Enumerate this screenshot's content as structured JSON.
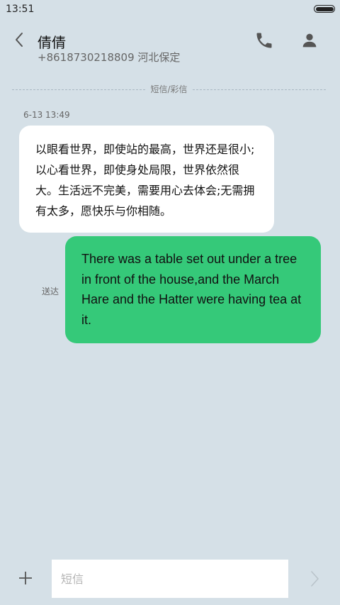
{
  "status_bar": {
    "time": "13:51",
    "battery_level": 1.0
  },
  "header": {
    "contact_name": "倩倩",
    "contact_sub": "+8618730218809 河北保定",
    "icons": {
      "back": "back-chevron-icon",
      "call": "phone-icon",
      "contact": "person-icon"
    }
  },
  "conversation": {
    "divider_label": "短信/彩信",
    "timestamp": "6-13 13:49",
    "incoming_message": "以眼看世界，即使站的最高，世界还是很小;以心看世界，即使身处局限，世界依然很大。生活远不完美，需要用心去体会;无需拥有太多，愿快乐与你相随。",
    "outgoing_message": "There was a table set out under a tree in front of the house,and the March Hare and the Hatter were having tea at it.",
    "outgoing_status": "送达",
    "colors": {
      "background": "#d5e0e7",
      "incoming_bubble": "#ffffff",
      "outgoing_bubble": "#35c979"
    }
  },
  "composer": {
    "placeholder": "短信",
    "value": "",
    "icons": {
      "add": "plus-icon",
      "send": "send-chevron-icon"
    }
  }
}
